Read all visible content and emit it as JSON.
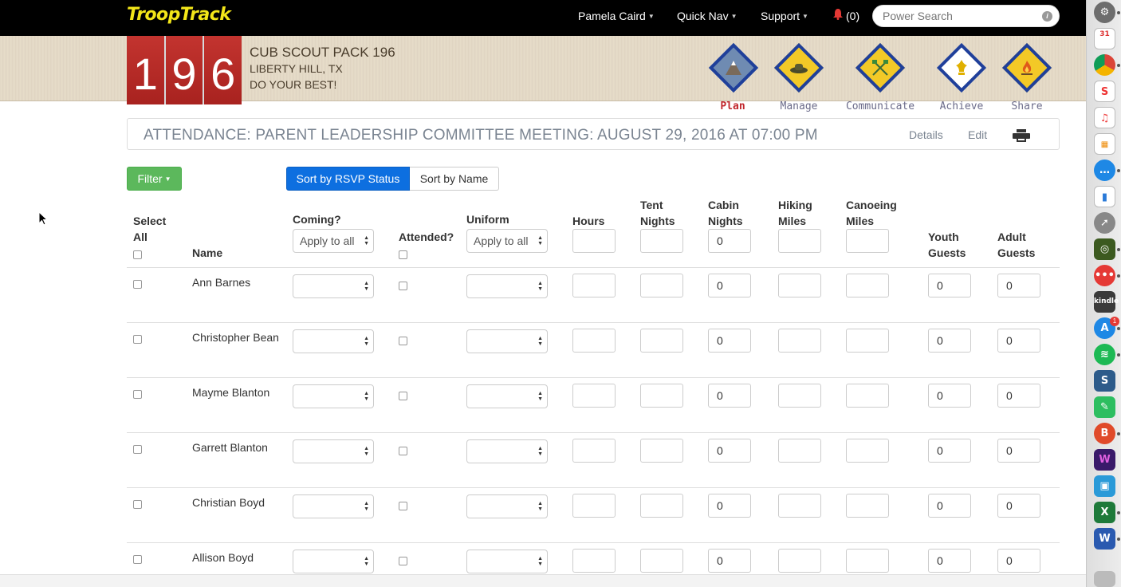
{
  "navbar": {
    "brand": "TroopTrack",
    "user_menu": "Pamela Caird",
    "quick_nav": "Quick Nav",
    "support": "Support",
    "notifications": "(0)",
    "search_placeholder": "Power Search"
  },
  "banner": {
    "pack_digits": [
      "1",
      "9",
      "6"
    ],
    "pack_name": "CUB SCOUT PACK 196",
    "location": "LIBERTY HILL, TX",
    "motto": "DO YOUR BEST!",
    "sections": [
      {
        "label": "Plan",
        "icon": "plan-icon",
        "active": true
      },
      {
        "label": "Manage",
        "icon": "manage-icon",
        "active": false
      },
      {
        "label": "Communicate",
        "icon": "communicate-icon",
        "active": false
      },
      {
        "label": "Achieve",
        "icon": "achieve-icon",
        "active": false
      },
      {
        "label": "Share",
        "icon": "share-icon",
        "active": false
      }
    ]
  },
  "page": {
    "title": "ATTENDANCE: PARENT LEADERSHIP COMMITTEE MEETING: AUGUST 29, 2016 AT 07:00 PM",
    "details_link": "Details",
    "edit_link": "Edit",
    "print_icon": "print-icon"
  },
  "toolbar": {
    "filter": "Filter",
    "sort_rsvp": "Sort by RSVP Status",
    "sort_name": "Sort by Name"
  },
  "table": {
    "headers": {
      "select_all_1": "Select",
      "select_all_2": "All",
      "name": "Name",
      "coming": "Coming?",
      "attended": "Attended?",
      "uniform": "Uniform",
      "hours": "Hours",
      "tent_1": "Tent",
      "tent_2": "Nights",
      "cabin_1": "Cabin",
      "cabin_2": "Nights",
      "hiking_1": "Hiking",
      "hiking_2": "Miles",
      "canoe_1": "Canoeing",
      "canoe_2": "Miles",
      "youth_1": "Youth",
      "youth_2": "Guests",
      "adult_1": "Adult",
      "adult_2": "Guests"
    },
    "apply_all": {
      "coming": "Apply to all",
      "uniform": "Apply to all",
      "cabin_nights": "0"
    },
    "rows": [
      {
        "name": "Ann Barnes",
        "cabin_nights": "0",
        "youth_guests": "0",
        "adult_guests": "0"
      },
      {
        "name": "Christopher Bean",
        "cabin_nights": "0",
        "youth_guests": "0",
        "adult_guests": "0"
      },
      {
        "name": "Mayme Blanton",
        "cabin_nights": "0",
        "youth_guests": "0",
        "adult_guests": "0"
      },
      {
        "name": "Garrett Blanton",
        "cabin_nights": "0",
        "youth_guests": "0",
        "adult_guests": "0"
      },
      {
        "name": "Christian Boyd",
        "cabin_nights": "0",
        "youth_guests": "0",
        "adult_guests": "0"
      },
      {
        "name": "Allison Boyd",
        "cabin_nights": "0",
        "youth_guests": "0",
        "adult_guests": "0"
      }
    ]
  },
  "dock": {
    "calendar_date": "31",
    "kindle": "kindle",
    "appstore_badge": "1",
    "word": "W",
    "excel": "X",
    "brave": "B"
  }
}
